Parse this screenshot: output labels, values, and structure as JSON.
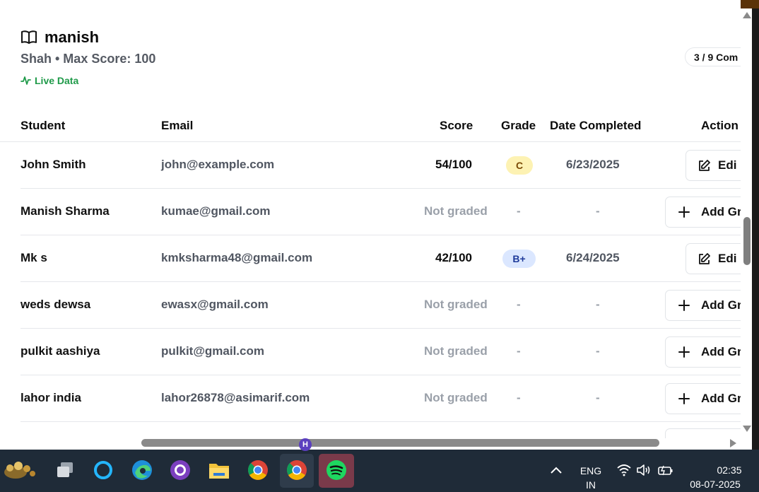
{
  "header": {
    "title": "manish",
    "subtitle": "Shah • Max Score: 100",
    "live_label": "Live Data",
    "completed": "3 / 9 Com"
  },
  "table": {
    "columns": [
      "Student",
      "Email",
      "Score",
      "Grade",
      "Date Completed",
      "Action"
    ],
    "rows": [
      {
        "student": "John Smith",
        "email": "john@example.com",
        "score": "54/100",
        "grade": "C",
        "date": "6/23/2025",
        "action": "Edi"
      },
      {
        "student": "Manish Sharma",
        "email": "kumae@gmail.com",
        "score": "Not graded",
        "grade": "-",
        "date": "-",
        "action": "Add Gr"
      },
      {
        "student": "Mk s",
        "email": "kmksharma48@gmail.com",
        "score": "42/100",
        "grade": "B+",
        "date": "6/24/2025",
        "action": "Edi"
      },
      {
        "student": "weds dewsa",
        "email": "ewasx@gmail.com",
        "score": "Not graded",
        "grade": "-",
        "date": "-",
        "action": "Add Gr"
      },
      {
        "student": "pulkit aashiya",
        "email": "pulkit@gmail.com",
        "score": "Not graded",
        "grade": "-",
        "date": "-",
        "action": "Add Gr"
      },
      {
        "student": "lahor india",
        "email": "lahor26878@asimarif.com",
        "score": "Not graded",
        "grade": "-",
        "date": "-",
        "action": "Add Gr"
      }
    ]
  },
  "colors": {
    "live": "#1f9a49",
    "badge_c_bg": "#fdf2b3",
    "badge_bplus_bg": "#dbe7ff",
    "taskbar": "#1f2b38"
  },
  "taskbar": {
    "apps": [
      "widgets-icon",
      "task-view-icon",
      "cortana-icon",
      "edge-icon",
      "github-icon",
      "file-explorer-icon",
      "chrome-icon",
      "chrome-profile-icon",
      "spotify-icon"
    ],
    "profile_badge": "H",
    "lang_top": "ENG",
    "lang_bottom": "IN",
    "time": "02:35",
    "date": "08-07-2025"
  }
}
